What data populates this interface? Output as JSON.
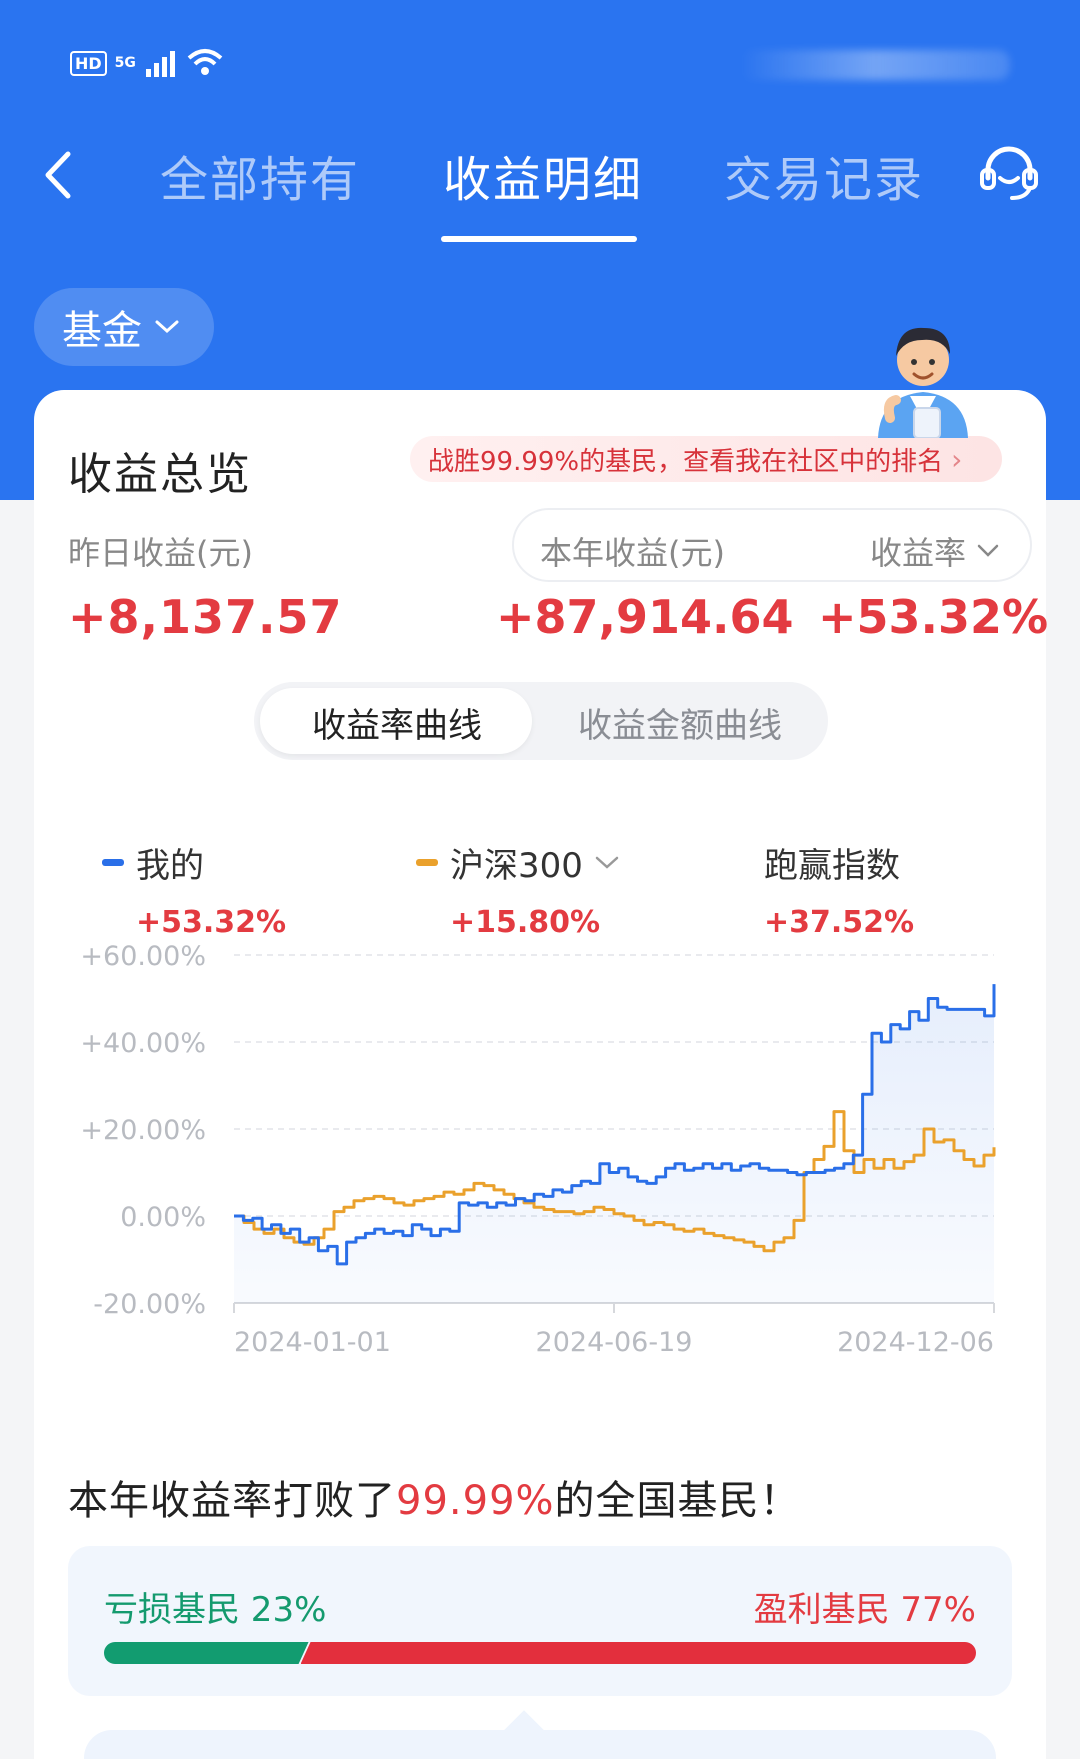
{
  "status_bar": {
    "hd": "HD",
    "network": "5G"
  },
  "nav": {
    "tabs": [
      {
        "label": "全部持有",
        "active": false
      },
      {
        "label": "收益明细",
        "active": true
      },
      {
        "label": "交易记录",
        "active": false
      }
    ],
    "icons": {
      "back": "back-arrow-icon",
      "service": "customer-service-icon"
    }
  },
  "filter": {
    "selected": "基金"
  },
  "overview": {
    "title": "收益总览",
    "rank_banner": "战胜99.99%的基民，查看我在社区中的排名",
    "yesterday": {
      "label": "昨日收益(元)",
      "value": "+8,137.57"
    },
    "this_year": {
      "label": "本年收益(元)",
      "value": "+87,914.64"
    },
    "rate": {
      "label": "收益率",
      "value": "+53.32%"
    }
  },
  "segment": {
    "options": [
      "收益率曲线",
      "收益金额曲线"
    ],
    "selected": 0
  },
  "legend": [
    {
      "name": "我的",
      "value": "+53.32%",
      "color": "#2a6fe8"
    },
    {
      "name": "沪深300",
      "value": "+15.80%",
      "color": "#eaa12c"
    },
    {
      "name": "跑赢指数",
      "value": "+37.52%"
    }
  ],
  "chart_data": {
    "type": "line",
    "y_ticks": [
      "+60.00%",
      "+40.00%",
      "+20.00%",
      "0.00%",
      "-20.00%"
    ],
    "ylim": [
      -20,
      60
    ],
    "x_ticks": [
      "2024-01-01",
      "2024-06-19",
      "2024-12-06"
    ],
    "grid": true,
    "series": [
      {
        "name": "我的",
        "color": "#2a6fe8",
        "values": [
          0,
          -1,
          -0.5,
          -3,
          -2,
          -4,
          -3,
          -6,
          -5,
          -8,
          -7,
          -11,
          -6,
          -5,
          -4,
          -3,
          -4,
          -3.5,
          -4.5,
          -2,
          -3,
          -4.5,
          -3,
          -3.5,
          3,
          2.5,
          3,
          2,
          3,
          2.5,
          4,
          3.5,
          5,
          4.5,
          6,
          5.5,
          7,
          8,
          7.5,
          12,
          10,
          11,
          9,
          8,
          7.5,
          9,
          11,
          12,
          10.5,
          11,
          12,
          11,
          12,
          10.5,
          11.5,
          12,
          11,
          10.5,
          10.5,
          10,
          9.5,
          10,
          10,
          10.5,
          11,
          12,
          14,
          28,
          42,
          40,
          44,
          43,
          47,
          45,
          50,
          48,
          47.5,
          47.5,
          47.5,
          47.5,
          46,
          53.32
        ]
      },
      {
        "name": "沪深300",
        "color": "#eaa12c",
        "values": [
          0,
          -1.5,
          -3,
          -4,
          -3,
          -5,
          -6,
          -6.5,
          -5,
          -3,
          1,
          2,
          3.5,
          4,
          4.5,
          4,
          3,
          2.5,
          3.5,
          4,
          4.5,
          5.5,
          5,
          6,
          7.5,
          7,
          6,
          5,
          4,
          3,
          2,
          1.5,
          1,
          1,
          0.5,
          1,
          2,
          1.5,
          0.5,
          0,
          -1,
          -2,
          -1.5,
          -2,
          -3,
          -3.5,
          -3,
          -4,
          -4.5,
          -5,
          -5.5,
          -6,
          -7,
          -8,
          -6,
          -5,
          -1,
          10,
          13,
          16,
          24,
          15,
          10,
          13,
          11,
          13,
          11,
          12.5,
          14,
          20,
          17,
          17.5,
          15,
          13,
          11.5,
          14,
          15.8
        ]
      }
    ]
  },
  "beat": {
    "prefix": "本年收益率打败了",
    "highlight": "99.99%",
    "suffix": "的全国基民！"
  },
  "distribution": {
    "loss_label": "亏损基民 23%",
    "profit_label": "盈利基民 77%",
    "loss_pct": 23,
    "profit_pct": 77,
    "loss_color": "#129c70",
    "profit_color": "#e32f3d"
  }
}
